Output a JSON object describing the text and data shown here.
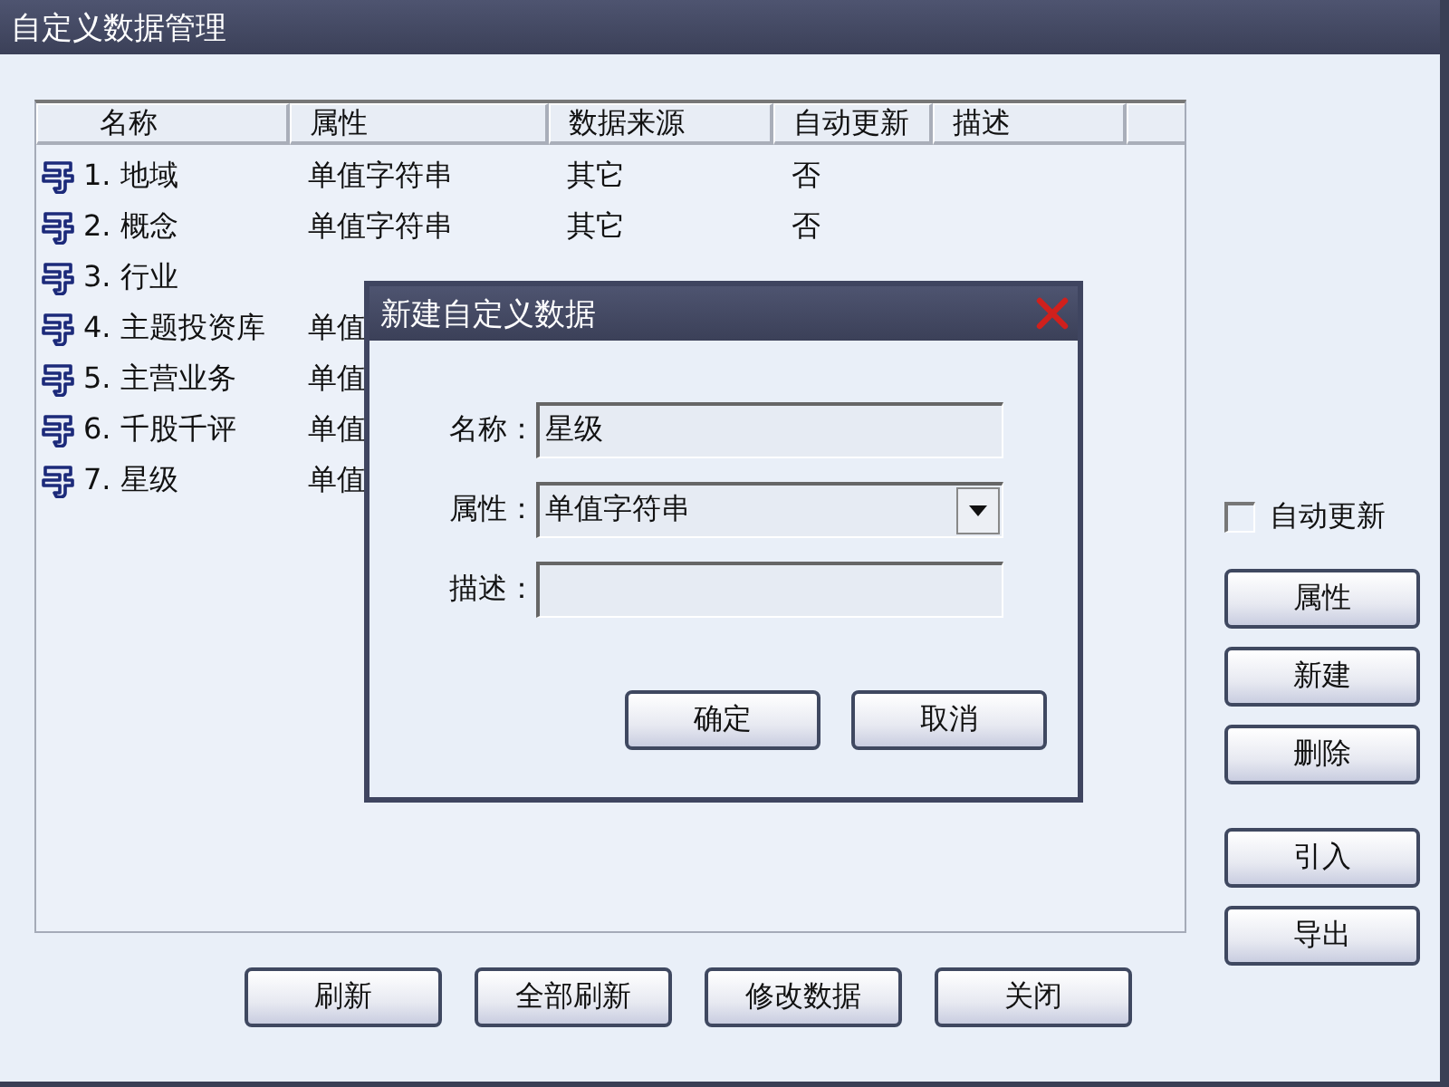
{
  "window": {
    "title": "自定义数据管理"
  },
  "table": {
    "columns": [
      "名称",
      "属性",
      "数据来源",
      "自动更新",
      "描述"
    ],
    "rows": [
      {
        "name": "1. 地域",
        "attribute": "单值字符串",
        "source": "其它",
        "auto_update": "否"
      },
      {
        "name": "2. 概念",
        "attribute": "单值字符串",
        "source": "其它",
        "auto_update": "否"
      },
      {
        "name": "3. 行业"
      },
      {
        "name": "4. 主题投资库",
        "attribute": "单值"
      },
      {
        "name": "5. 主营业务",
        "attribute": "单值"
      },
      {
        "name": "6. 千股千评",
        "attribute": "单值"
      },
      {
        "name": "7. 星级",
        "attribute": "单值"
      }
    ]
  },
  "auto_update_checkbox": {
    "label": "自动更新",
    "checked": false
  },
  "side_buttons": [
    "属性",
    "新建",
    "删除",
    "引入",
    "导出"
  ],
  "bottom_buttons": [
    "刷新",
    "全部刷新",
    "修改数据",
    "关闭"
  ],
  "dialog": {
    "title": "新建自定义数据",
    "fields": [
      {
        "kind": "text",
        "label": "名称：",
        "value": "星级"
      },
      {
        "kind": "select",
        "label": "属性：",
        "value": "单值字符串"
      },
      {
        "kind": "text",
        "label": "描述："
      }
    ],
    "buttons": [
      "确定",
      "取消"
    ]
  }
}
